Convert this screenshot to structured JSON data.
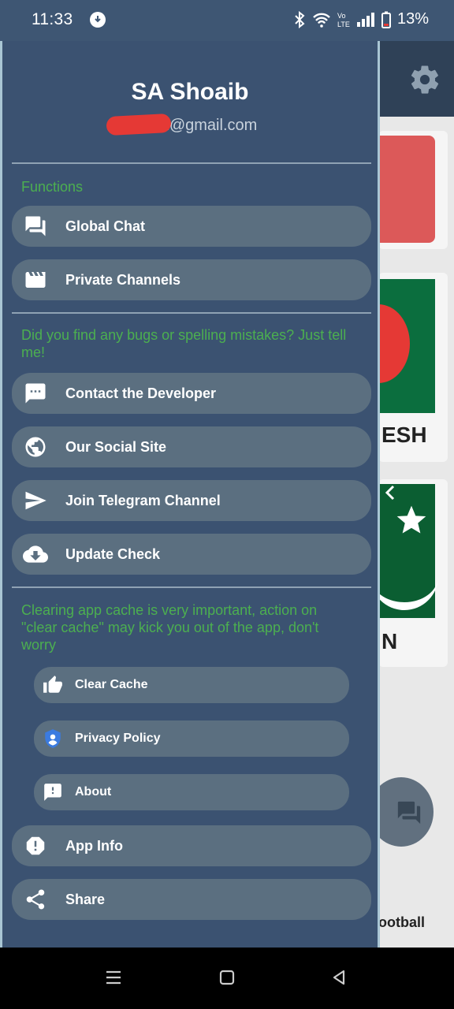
{
  "status": {
    "time": "11:33",
    "battery": "13%"
  },
  "profile": {
    "name": "SA Shoaib",
    "email": "2@gmail.com"
  },
  "sections": {
    "functions": "Functions",
    "bugs_note": "Did you find any bugs or spelling mistakes? Just tell me!",
    "cache_note": "Clearing app cache is very important, action on \"clear cache\" may kick you out of the app, don't worry"
  },
  "menu": {
    "global_chat": "Global Chat",
    "private_channels": "Private Channels",
    "contact_developer": "Contact the Developer",
    "social_site": "Our Social Site",
    "telegram": "Join Telegram Channel",
    "update_check": "Update Check",
    "clear_cache": "Clear Cache",
    "privacy_policy": "Privacy Policy",
    "about": "About",
    "app_info": "App Info",
    "share": "Share"
  },
  "background": {
    "card2_text": "ESH",
    "card3_text": "N",
    "bottom_label": "ootball"
  },
  "colors": {
    "drawer": "#3b5271",
    "item": "#5b6f80",
    "note": "#4caf50",
    "accent_border": "#a9c6d4"
  }
}
